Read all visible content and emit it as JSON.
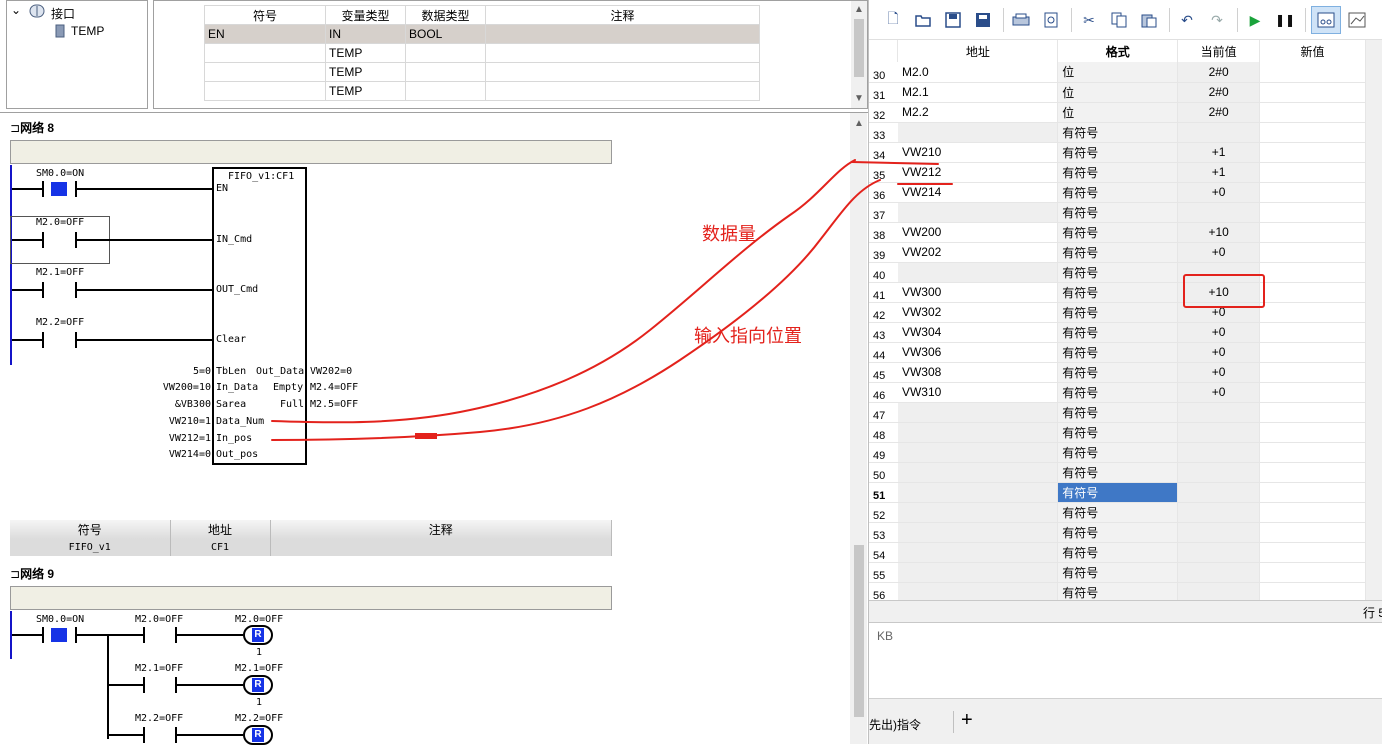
{
  "tree": {
    "root": "接口",
    "child": "TEMP"
  },
  "interface_table": {
    "headers": [
      "符号",
      "变量类型",
      "数据类型",
      "注释"
    ],
    "rows": [
      [
        "EN",
        "IN",
        "BOOL",
        ""
      ],
      [
        "",
        "TEMP",
        "",
        ""
      ],
      [
        "",
        "TEMP",
        "",
        ""
      ],
      [
        "",
        "TEMP",
        "",
        ""
      ]
    ]
  },
  "network8": {
    "title": "网络 8",
    "contact_sm0": "SM0.0=ON",
    "contact_m20": "M2.0=OFF",
    "contact_m21": "M2.1=OFF",
    "contact_m22": "M2.2=OFF",
    "box_title": "FIFO_v1:CF1",
    "pins_left": [
      "EN",
      "IN_Cmd",
      "OUT_Cmd",
      "Clear",
      "TbLen",
      "In_Data",
      "Sarea",
      "Data_Num",
      "In_pos",
      "Out_pos"
    ],
    "pins_right": [
      "Out_Data",
      "Empty",
      "Full"
    ],
    "left_values": [
      "5=0",
      "VW200=10",
      "&VB300",
      "VW210=1",
      "VW212=1",
      "VW214=0"
    ],
    "right_values": [
      "VW202=0",
      "M2.4=OFF",
      "M2.5=OFF"
    ],
    "symbol_table": {
      "headers": [
        "符号",
        "地址",
        "注释"
      ],
      "row": [
        "FIFO_v1",
        "CF1",
        ""
      ]
    }
  },
  "network9": {
    "title": "网络 9",
    "contact_sm0": "SM0.0=ON",
    "rows": [
      {
        "contact": "M2.0=OFF",
        "coil": "M2.0=OFF",
        "coil_type": "R",
        "n": "1"
      },
      {
        "contact": "M2.1=OFF",
        "coil": "M2.1=OFF",
        "coil_type": "R",
        "n": "1"
      },
      {
        "contact": "M2.2=OFF",
        "coil": "M2.2=OFF",
        "coil_type": "R",
        "n": ""
      }
    ]
  },
  "status_chart": {
    "headers": [
      "地址",
      "格式",
      "当前值",
      "新值"
    ],
    "rows": [
      [
        "30",
        "M2.0",
        "位",
        "2#0"
      ],
      [
        "31",
        "M2.1",
        "位",
        "2#0"
      ],
      [
        "32",
        "M2.2",
        "位",
        "2#0"
      ],
      [
        "33",
        "",
        "有符号",
        ""
      ],
      [
        "34",
        "VW210",
        "有符号",
        "+1"
      ],
      [
        "35",
        "VW212",
        "有符号",
        "+1"
      ],
      [
        "36",
        "VW214",
        "有符号",
        "+0"
      ],
      [
        "37",
        "",
        "有符号",
        ""
      ],
      [
        "38",
        "VW200",
        "有符号",
        "+10"
      ],
      [
        "39",
        "VW202",
        "有符号",
        "+0"
      ],
      [
        "40",
        "",
        "有符号",
        ""
      ],
      [
        "41",
        "VW300",
        "有符号",
        "+10"
      ],
      [
        "42",
        "VW302",
        "有符号",
        "+0"
      ],
      [
        "43",
        "VW304",
        "有符号",
        "+0"
      ],
      [
        "44",
        "VW306",
        "有符号",
        "+0"
      ],
      [
        "45",
        "VW308",
        "有符号",
        "+0"
      ],
      [
        "46",
        "VW310",
        "有符号",
        "+0"
      ],
      [
        "47",
        "",
        "有符号",
        ""
      ],
      [
        "48",
        "",
        "有符号",
        ""
      ],
      [
        "49",
        "",
        "有符号",
        ""
      ],
      [
        "50",
        "",
        "有符号",
        ""
      ],
      [
        "51",
        "",
        "有符号",
        ""
      ],
      [
        "52",
        "",
        "有符号",
        ""
      ],
      [
        "53",
        "",
        "有符号",
        ""
      ],
      [
        "54",
        "",
        "有符号",
        ""
      ],
      [
        "55",
        "",
        "有符号",
        ""
      ],
      [
        "56",
        "",
        "有符号",
        ""
      ]
    ],
    "selected_row": "51"
  },
  "status_strip": "行 5",
  "lower_label": "KB",
  "bottom_tab": "先出)指令",
  "add_tab": "+",
  "annotations": {
    "data_count": "数据量",
    "input_pos": "输入指向位置",
    "color": "#e3221c"
  }
}
